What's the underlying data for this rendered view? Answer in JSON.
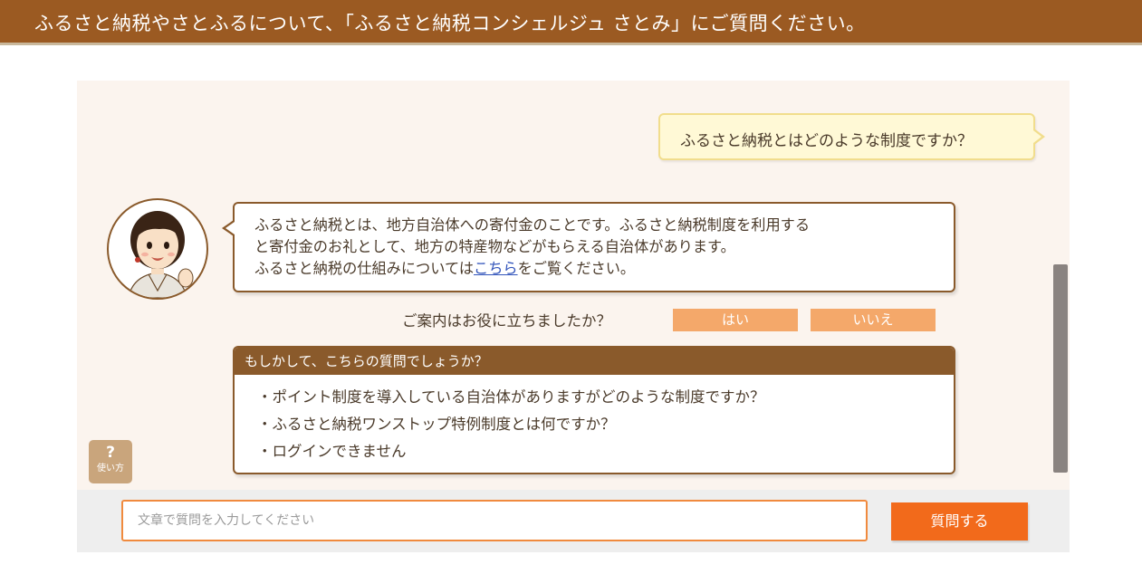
{
  "header": {
    "title": "ふるさと納税やさとふるについて、「ふるさと納税コンシェルジュ さとみ」にご質問ください。"
  },
  "conversation": {
    "user_message": "ふるさと納税とはどのような制度ですか？",
    "bot_answer": {
      "line1": "ふるさと納税とは、地方自治体への寄付金のことです。ふるさと納税制度を利用する",
      "line2": "と寄付金のお礼として、地方の特産物などがもらえる自治体があります。",
      "line3_prefix": "ふるさと納税の仕組みについては",
      "line3_link": "こちら",
      "line3_suffix": "をご覧ください。"
    },
    "avatar_icon": "concierge-avatar"
  },
  "feedback": {
    "question": "ご案内はお役に立ちましたか？",
    "yes_label": "はい",
    "no_label": "いいえ"
  },
  "suggestions": {
    "header": "もしかして、こちらの質問でしょうか？",
    "items": [
      {
        "label": "・ポイント制度を導入している自治体がありますがどのような制度ですか？"
      },
      {
        "label": "・ふるさと納税ワンストップ特例制度とは何ですか？"
      },
      {
        "label": "・ログインできません"
      }
    ]
  },
  "help": {
    "icon": "?",
    "label": "使い方"
  },
  "input": {
    "placeholder": "文章で質問を入力してください",
    "submit_label": "質問する"
  },
  "colors": {
    "header_bg": "#9b5a22",
    "accent_brown": "#8a5a2b",
    "submit_orange": "#f26a1b",
    "feedback_orange": "#f4a86a",
    "user_bubble_bg": "#fff9d6"
  }
}
